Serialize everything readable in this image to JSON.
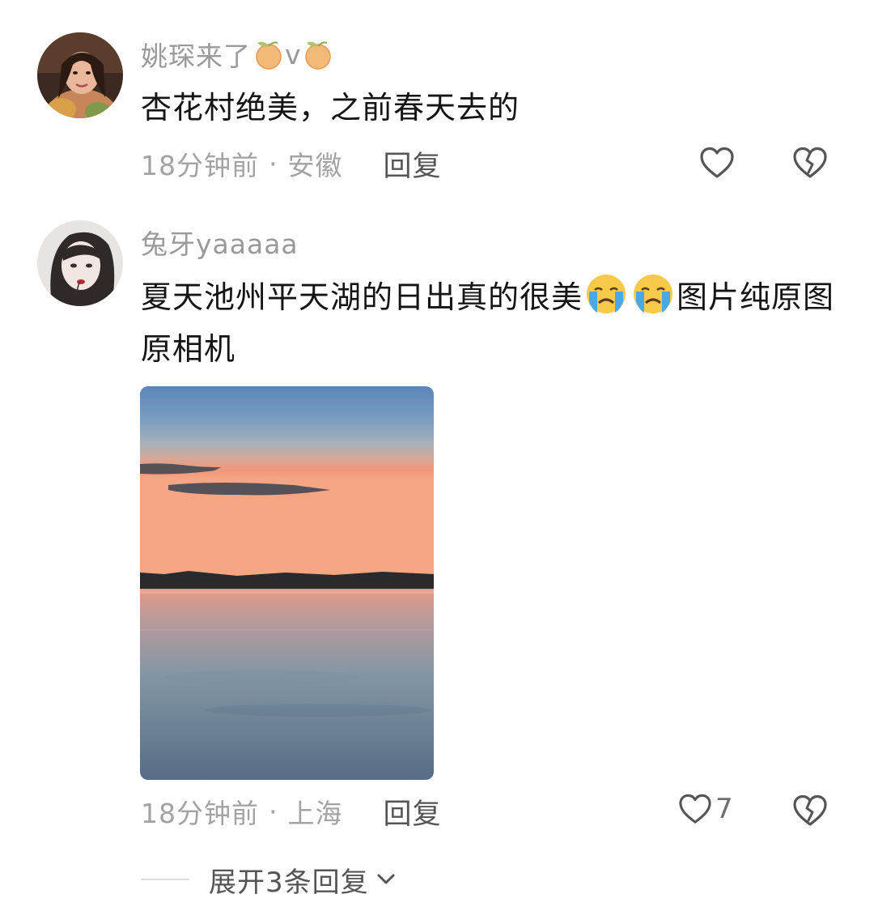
{
  "comments": [
    {
      "username": "姚琛来了",
      "badge_middle": "v",
      "badge_icon": "peach-fruit-icon",
      "text": "杏花村绝美，之前春天去的",
      "time": "18分钟前",
      "separator": "·",
      "location": "安徽",
      "reply_label": "回复",
      "like_count": "",
      "has_image": false
    },
    {
      "username": "兔牙yaaaaa",
      "text_before_emoji": "夏天池州平天湖的日出真的很美",
      "emoji": "loudly-crying-face-emoji",
      "emoji_count": 2,
      "text_after_emoji": "图片纯原图原相机",
      "time": "18分钟前",
      "separator": "·",
      "location": "上海",
      "reply_label": "回复",
      "like_count": "7",
      "has_image": true,
      "image_icon": "lake-sunrise-photo"
    }
  ],
  "expand": {
    "label": "展开3条回复"
  },
  "colors": {
    "text_primary": "#151515",
    "text_secondary": "#9a9a9a",
    "reply_link": "#555555",
    "icon_stroke": "#555555"
  }
}
